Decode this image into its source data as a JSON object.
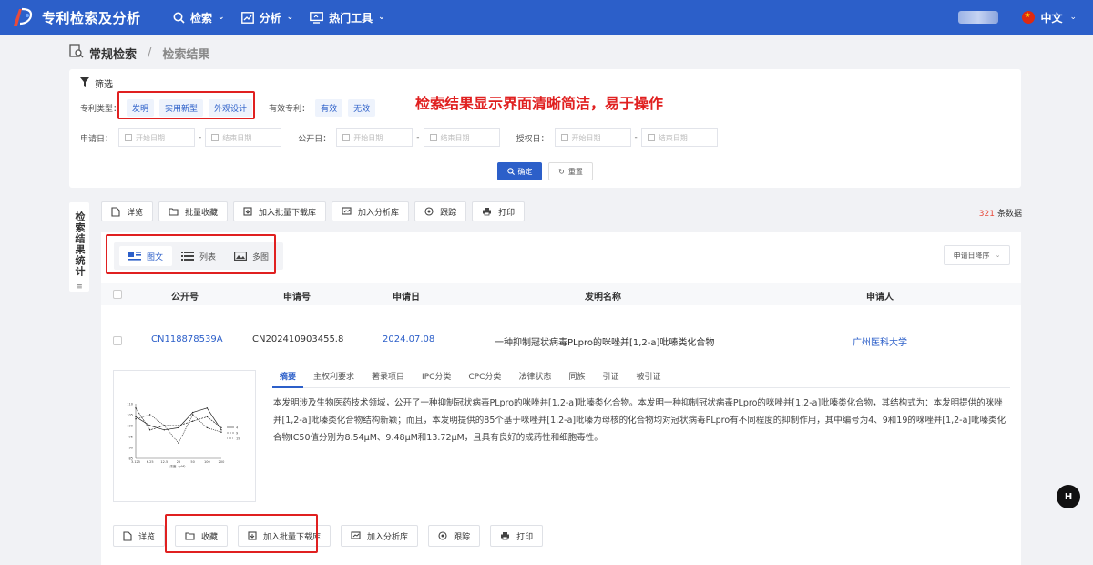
{
  "app": {
    "title": "专利检索及分析"
  },
  "nav": {
    "items": [
      {
        "label": "检索",
        "icon": "search-icon"
      },
      {
        "label": "分析",
        "icon": "chart-icon"
      },
      {
        "label": "热门工具",
        "icon": "monitor-icon"
      }
    ],
    "language": "中文"
  },
  "breadcrumb": {
    "root": "常规检索",
    "separator": "/",
    "current": "检索结果"
  },
  "filter": {
    "title": "筛选",
    "patent_type_label": "专利类型：",
    "patent_types": [
      "发明",
      "实用新型",
      "外观设计"
    ],
    "valid_label": "有效专利：",
    "valid_options": [
      "有效",
      "无效"
    ],
    "annotation": "检索结果显示界面清晰简洁，易于操作",
    "dates": [
      {
        "label": "申请日：",
        "start": "开始日期",
        "end": "结束日期"
      },
      {
        "label": "公开日：",
        "start": "开始日期",
        "end": "结束日期"
      },
      {
        "label": "授权日：",
        "start": "开始日期",
        "end": "结束日期"
      }
    ],
    "confirm": "确定",
    "reset": "重置"
  },
  "sidebar_tab": {
    "label": "检索结果统计"
  },
  "toolbar": {
    "buttons": [
      "详览",
      "批量收藏",
      "加入批量下载库",
      "加入分析库",
      "跟踪",
      "打印"
    ],
    "count": "321",
    "count_suffix": "条数据"
  },
  "view_tabs": [
    "图文",
    "列表",
    "多图"
  ],
  "sort": "申请日降序",
  "table": {
    "headers": [
      "公开号",
      "申请号",
      "申请日",
      "发明名称",
      "申请人"
    ],
    "row": {
      "pub_no": "CN118878539A",
      "app_no": "CN202410903455.8",
      "app_date": "2024.07.08",
      "title": "一种抑制冠状病毒PLpro的咪唑并[1,2-a]吡嗪类化合物",
      "applicant": "广州医科大学"
    }
  },
  "detail_tabs": [
    "摘要",
    "主权利要求",
    "著录项目",
    "IPC分类",
    "CPC分类",
    "法律状态",
    "同族",
    "引证",
    "被引证"
  ],
  "abstract": "本发明涉及生物医药技术领域，公开了一种抑制冠状病毒PLpro的咪唑并[1,2-a]吡嗪类化合物。本发明一种抑制冠状病毒PLpro的咪唑并[1,2-a]吡嗪类化合物，其结构式为：本发明提供的咪唑并[1,2-a]吡嗪类化合物结构新颖；而且，本发明提供的85个基于咪唑并[1,2-a]吡嗪为母核的化合物均对冠状病毒PLpro有不同程度的抑制作用，其中编号为4、9和19的咪唑并[1,2-a]吡嗪类化合物IC50值分别为8.54μM、9.48μM和13.72μM，且具有良好的成药性和细胞毒性。",
  "thumbnail": {
    "chart_data": {
      "type": "line",
      "x": [
        "3.125",
        "6.25",
        "12.5",
        "25",
        "50",
        "100",
        "200"
      ],
      "series": [
        {
          "name": "4",
          "values": [
            104,
            100,
            98,
            99,
            106,
            108,
            98
          ]
        },
        {
          "name": "9",
          "values": [
            108,
            98,
            100,
            100,
            102,
            104,
            99
          ]
        },
        {
          "name": "19",
          "values": [
            103,
            105,
            100,
            92,
            105,
            99,
            97
          ]
        }
      ],
      "yticks": [
        "110",
        "105",
        "100",
        "95",
        "90",
        "85"
      ],
      "xlabel": "浓度（μM）",
      "ylim": [
        85,
        110
      ]
    }
  },
  "row_actions": [
    "详览",
    "收藏",
    "加入批量下载库",
    "加入分析库",
    "跟踪",
    "打印"
  ],
  "float_button": "H"
}
